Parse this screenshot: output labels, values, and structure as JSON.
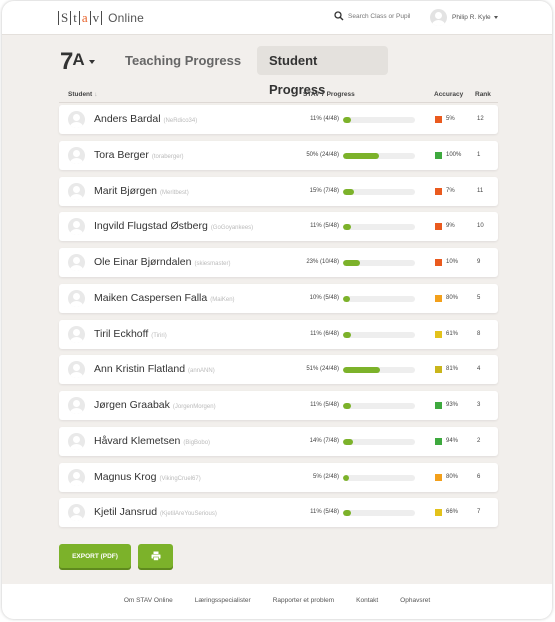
{
  "app": {
    "logo_letters": [
      "S",
      "t",
      "a",
      "v"
    ],
    "logo_suffix": "Online"
  },
  "search": {
    "placeholder": "Search Class or Pupil"
  },
  "user": {
    "name": "Philip R. Kyle"
  },
  "class_selector": {
    "number": "7",
    "letter": "A"
  },
  "tabs": [
    {
      "label": "Teaching Progress",
      "active": false
    },
    {
      "label": "Student Progress",
      "active": true
    }
  ],
  "table": {
    "headers": {
      "student": "Student",
      "student_sort": "↓",
      "progress": "STAV 7 Progress",
      "accuracy": "Accuracy",
      "rank": "Rank"
    },
    "rows": [
      {
        "name": "Anders Bardal",
        "username": "(NeRdico34)",
        "progress_text": "11% (4/48)",
        "progress": 0.11,
        "accuracy_text": "5%",
        "accuracy_color": "#ea5a1e",
        "rank": "12"
      },
      {
        "name": "Tora Berger",
        "username": "(toraberger)",
        "progress_text": "50% (24/48)",
        "progress": 0.5,
        "accuracy_text": "100%",
        "accuracy_color": "#3ea93e",
        "rank": "1"
      },
      {
        "name": "Marit Bjørgen",
        "username": "(Meritbest)",
        "progress_text": "15% (7/48)",
        "progress": 0.15,
        "accuracy_text": "7%",
        "accuracy_color": "#ea5a1e",
        "rank": "11"
      },
      {
        "name": "Ingvild Flugstad Østberg",
        "username": "(GoGoyankees)",
        "progress_text": "11% (5/48)",
        "progress": 0.11,
        "accuracy_text": "9%",
        "accuracy_color": "#ea5a1e",
        "rank": "10"
      },
      {
        "name": "Ole Einar Bjørndalen",
        "username": "(skiesmaster)",
        "progress_text": "23% (10/48)",
        "progress": 0.23,
        "accuracy_text": "10%",
        "accuracy_color": "#ea5a1e",
        "rank": "9"
      },
      {
        "name": "Maiken Caspersen Falla",
        "username": "(MaiKen)",
        "progress_text": "10% (5/48)",
        "progress": 0.1,
        "accuracy_text": "80%",
        "accuracy_color": "#f3a01b",
        "rank": "5"
      },
      {
        "name": "Tiril Eckhoff",
        "username": "(Tiriri)",
        "progress_text": "11% (6/48)",
        "progress": 0.11,
        "accuracy_text": "61%",
        "accuracy_color": "#e3c21b",
        "rank": "8"
      },
      {
        "name": "Ann Kristin Flatland",
        "username": "(annANN)",
        "progress_text": "51% (24/48)",
        "progress": 0.51,
        "accuracy_text": "81%",
        "accuracy_color": "#c9b51b",
        "rank": "4"
      },
      {
        "name": "Jørgen Graabak",
        "username": "(JorgenMorgen)",
        "progress_text": "11% (5/48)",
        "progress": 0.11,
        "accuracy_text": "93%",
        "accuracy_color": "#3ea93e",
        "rank": "3"
      },
      {
        "name": "Håvard Klemetsen",
        "username": "(BigBobo)",
        "progress_text": "14% (7/48)",
        "progress": 0.14,
        "accuracy_text": "94%",
        "accuracy_color": "#3ea93e",
        "rank": "2"
      },
      {
        "name": "Magnus Krog",
        "username": "(VikingCruel67)",
        "progress_text": "5% (2/48)",
        "progress": 0.05,
        "accuracy_text": "80%",
        "accuracy_color": "#f3a01b",
        "rank": "6"
      },
      {
        "name": "Kjetil Jansrud",
        "username": "(KjetilAreYouSerious)",
        "progress_text": "11% (5/48)",
        "progress": 0.11,
        "accuracy_text": "66%",
        "accuracy_color": "#e3c21b",
        "rank": "7"
      }
    ]
  },
  "actions": {
    "export_label": "EXPORT (PDF)",
    "print_icon": "printer-icon"
  },
  "footer": {
    "links": [
      "Om STAV Online",
      "Læringsspecialister",
      "Rapporter et problem",
      "Kontakt",
      "Ophavsret"
    ]
  },
  "colors": {
    "accent_green": "#7cb22a",
    "logo_accent": "#e8622a",
    "background": "#f2efec"
  }
}
